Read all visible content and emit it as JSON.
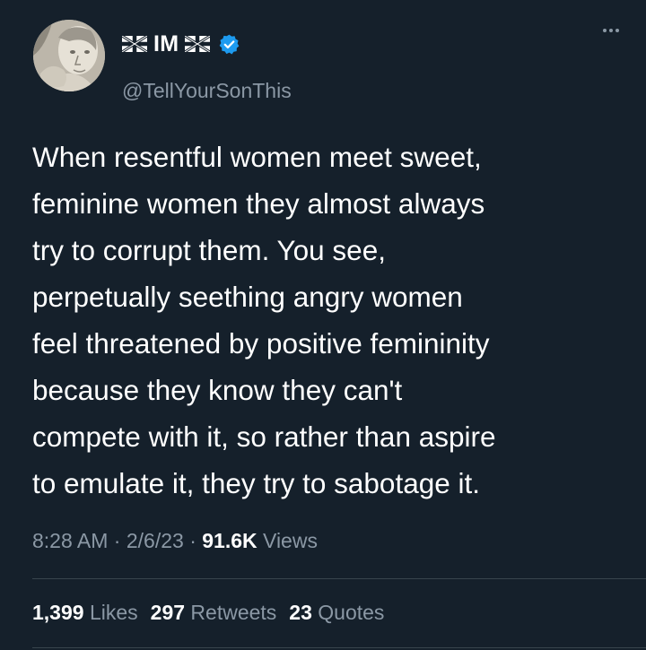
{
  "author": {
    "display_name": "IM",
    "handle": "@TellYourSonThis",
    "left_flag_icon": "uk-flag-icon",
    "right_flag_icon": "uk-flag-icon",
    "verified_icon": "verified-badge-icon",
    "verified_color": "#1d9bf0"
  },
  "menu": {
    "icon": "more-options-icon"
  },
  "tweet": {
    "text": "When resentful women meet sweet,\nfeminine women they almost always\ntry to corrupt them. You see,\nperpetually seething angry women\nfeel threatened by positive femininity\nbecause they know they can't\ncompete with it, so rather than aspire\nto emulate it, they try to sabotage it."
  },
  "meta": {
    "time": "8:28 AM",
    "separator": "·",
    "date": "2/6/23",
    "views_count": "91.6K",
    "views_label": "Views"
  },
  "stats": {
    "likes_count": "1,399",
    "likes_label": "Likes",
    "retweets_count": "297",
    "retweets_label": "Retweets",
    "quotes_count": "23",
    "quotes_label": "Quotes"
  },
  "colors": {
    "background": "#15202b",
    "text_primary": "#ffffff",
    "text_secondary": "#8b98a5",
    "divider": "#38444d"
  }
}
